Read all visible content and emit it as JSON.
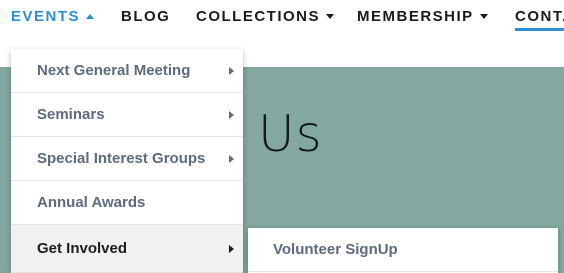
{
  "nav": {
    "events": "EVENTS",
    "blog": "BLOG",
    "collections": "COLLECTIONS",
    "membership": "MEMBERSHIP",
    "contact": "CONTA",
    "accent_color": "#2b8fd2"
  },
  "hero": {
    "title": "Us",
    "background_color": "#82a8a0"
  },
  "dropdown": {
    "items": [
      {
        "label": "Next General Meeting",
        "has_submenu": true
      },
      {
        "label": "Seminars",
        "has_submenu": true
      },
      {
        "label": "Special Interest Groups",
        "has_submenu": true
      },
      {
        "label": "Annual Awards",
        "has_submenu": false
      },
      {
        "label": "Get Involved",
        "has_submenu": true,
        "active": true
      }
    ]
  },
  "submenu": {
    "items": [
      {
        "label": "Volunteer SignUp"
      }
    ]
  }
}
